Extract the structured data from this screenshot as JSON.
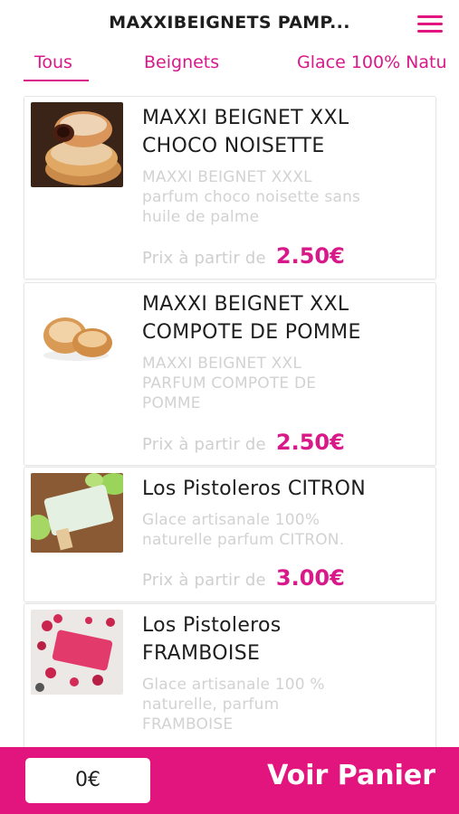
{
  "header": {
    "title": "MAXXIBEIGNETS PAMP...",
    "menu_icon": "hamburger-menu-icon"
  },
  "tabs": [
    {
      "label": "Tous",
      "active": true
    },
    {
      "label": "Beignets",
      "active": false
    },
    {
      "label": "Glace 100% Natu",
      "active": false
    }
  ],
  "products": [
    {
      "title_line1": "MAXXI BEIGNET XXL",
      "title_line2": "CHOCO NOISETTE",
      "desc_line1": "MAXXI BEIGNET XXXL",
      "desc_line2": "parfum choco noisette sans",
      "desc_line3": "huile de palme",
      "price_label": "Prix à partir de",
      "price": "2.50€",
      "image": "chocolate-doughnut-image"
    },
    {
      "title_line1": "MAXXI BEIGNET XXL",
      "title_line2": "COMPOTE DE POMME",
      "desc_line1": "MAXXI BEIGNET XXL",
      "desc_line2": "PARFUM COMPOTE DE",
      "desc_line3": "POMME",
      "price_label": "Prix à partir de",
      "price": "2.50€",
      "image": "apple-doughnut-image"
    },
    {
      "title_line1": "Los Pistoleros CITRON",
      "desc_line1": "Glace artisanale 100%",
      "desc_line2": "naturelle parfum CITRON.",
      "price_label": "Prix à partir de",
      "price": "3.00€",
      "image": "lemon-popsicle-image"
    },
    {
      "title_line1": "Los Pistoleros",
      "title_line2": "FRAMBOISE",
      "desc_line1": "Glace artisanale 100 %",
      "desc_line2": "naturelle, parfum",
      "desc_line3": "FRAMBOISE",
      "image": "raspberry-popsicle-image"
    }
  ],
  "footer": {
    "cart_total": "0€",
    "cta_label": "Voir Panier"
  },
  "colors": {
    "accent": "#e2157e",
    "title_text": "#1e1e1e",
    "muted_text": "#d2d2d2"
  }
}
